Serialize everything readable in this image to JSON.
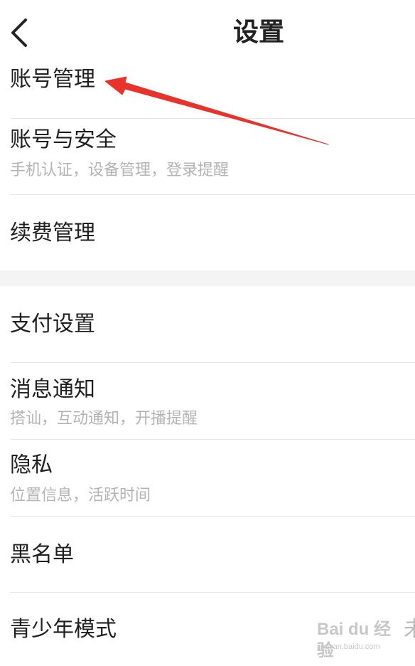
{
  "header": {
    "title": "设置",
    "back_icon": "chevron-left-icon"
  },
  "sections": [
    {
      "items": [
        {
          "title": "账号管理",
          "subtitle": ""
        },
        {
          "title": "账号与安全",
          "subtitle": "手机认证，设备管理，登录提醒"
        },
        {
          "title": "续费管理",
          "subtitle": ""
        }
      ]
    },
    {
      "items": [
        {
          "title": "支付设置",
          "subtitle": ""
        },
        {
          "title": "消息通知",
          "subtitle": "搭讪，互动通知，开播提醒"
        },
        {
          "title": "隐私",
          "subtitle": "位置信息，活跃时间"
        },
        {
          "title": "黑名单",
          "subtitle": ""
        },
        {
          "title": "青少年模式",
          "subtitle": "",
          "status": "未"
        }
      ]
    }
  ],
  "annotation": {
    "arrow_color": "#e8332b"
  },
  "watermark": {
    "logo_text": "Bai du 经验",
    "url": "jingyan.baidu.com"
  }
}
